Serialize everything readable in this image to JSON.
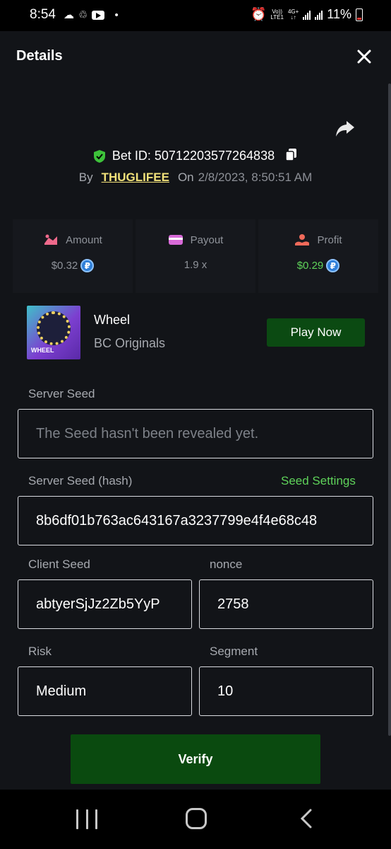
{
  "status_bar": {
    "time": "8:54",
    "network_top": "Vo))",
    "network_bottom": "LTE1",
    "gen_top": "4G+",
    "gen_bottom": "↓↑",
    "battery": "11%"
  },
  "header": {
    "title": "Details"
  },
  "bet": {
    "id_label": "Bet ID: 50712203577264838",
    "by_label": "By",
    "user": "THUGLIFEE",
    "on_label": "On",
    "date": "2/8/2023, 8:50:51 AM"
  },
  "stats": {
    "amount_label": "Amount",
    "amount_value": "$0.32",
    "payout_label": "Payout",
    "payout_value": "1.9 x",
    "profit_label": "Profit",
    "profit_value": "$0.29",
    "coin_symbol": "₽"
  },
  "game": {
    "name": "Wheel",
    "provider": "BC Originals",
    "thumb_label": "WHEEL",
    "play_label": "Play Now"
  },
  "form": {
    "server_seed_label": "Server Seed",
    "server_seed_value": "The Seed hasn't been revealed yet.",
    "server_hash_label": "Server Seed (hash)",
    "seed_settings_label": "Seed Settings",
    "server_hash_value": "8b6df01b763ac643167a3237799e4f4e68c48",
    "client_seed_label": "Client Seed",
    "client_seed_value": "abtyerSjJz2Zb5YyP",
    "nonce_label": "nonce",
    "nonce_value": "2758",
    "risk_label": "Risk",
    "risk_value": "Medium",
    "segment_label": "Segment",
    "segment_value": "10"
  },
  "verify_label": "Verify",
  "colors": {
    "accent_green": "#5fd35a",
    "button_green": "#0b4a12",
    "username_yellow": "#f2e27a",
    "background": "#121418"
  }
}
